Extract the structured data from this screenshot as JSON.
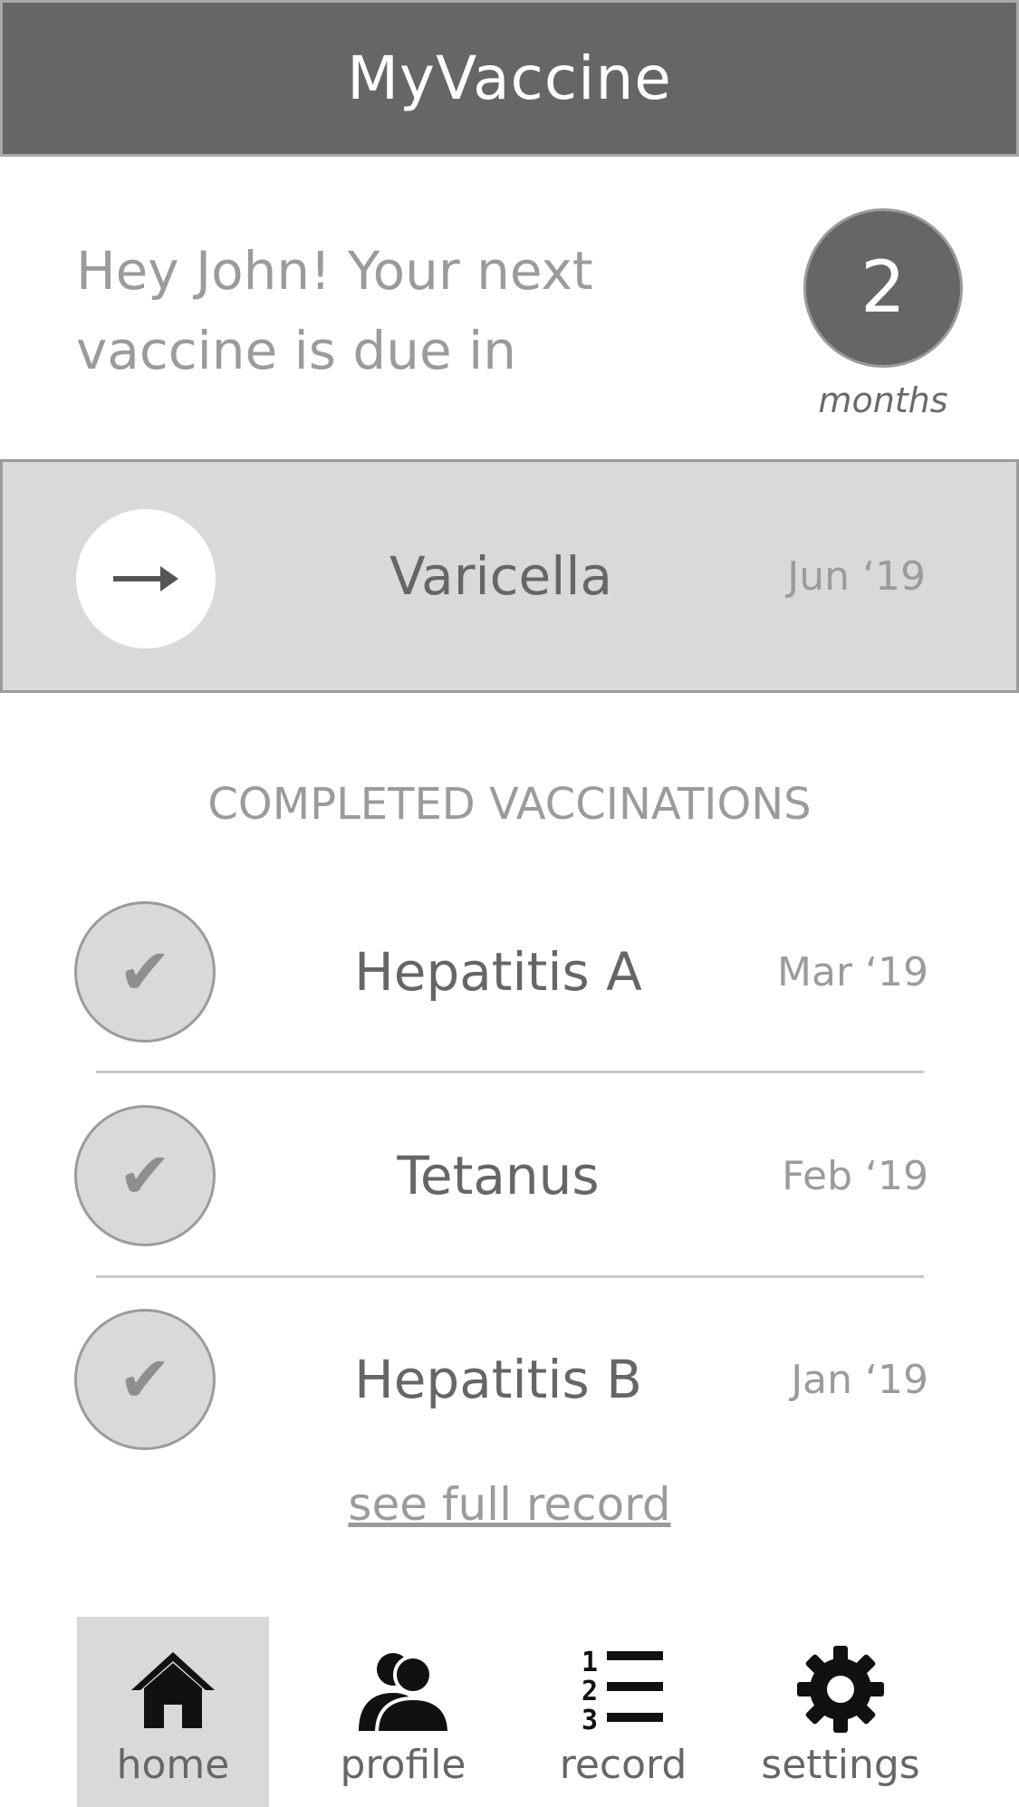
{
  "header": {
    "title": "MyVaccine"
  },
  "greeting": {
    "text": "Hey John! Your next vaccine is due in",
    "due_value": "2",
    "due_unit": "months"
  },
  "next_vaccine": {
    "name": "Varicella",
    "date": "Jun ‘19",
    "icon": "arrow-right-icon"
  },
  "completed": {
    "title": "COMPLETED VACCINATIONS",
    "items": [
      {
        "name": "Hepatitis A",
        "date": "Mar ‘19",
        "icon": "check-icon"
      },
      {
        "name": "Tetanus",
        "date": "Feb ‘19",
        "icon": "check-icon"
      },
      {
        "name": "Hepatitis B",
        "date": "Jan ‘19",
        "icon": "check-icon"
      }
    ],
    "full_record_link": "see full record"
  },
  "tabs": [
    {
      "label": "home",
      "icon": "home-icon",
      "active": true
    },
    {
      "label": "profile",
      "icon": "profile-icon",
      "active": false
    },
    {
      "label": "record",
      "icon": "record-list-icon",
      "active": false
    },
    {
      "label": "settings",
      "icon": "gear-icon",
      "active": false
    }
  ],
  "colors": {
    "header_bg": "#666666",
    "card_bg": "#d9d9d9",
    "text_light": "#9b9b9b",
    "text_dark": "#666666"
  }
}
